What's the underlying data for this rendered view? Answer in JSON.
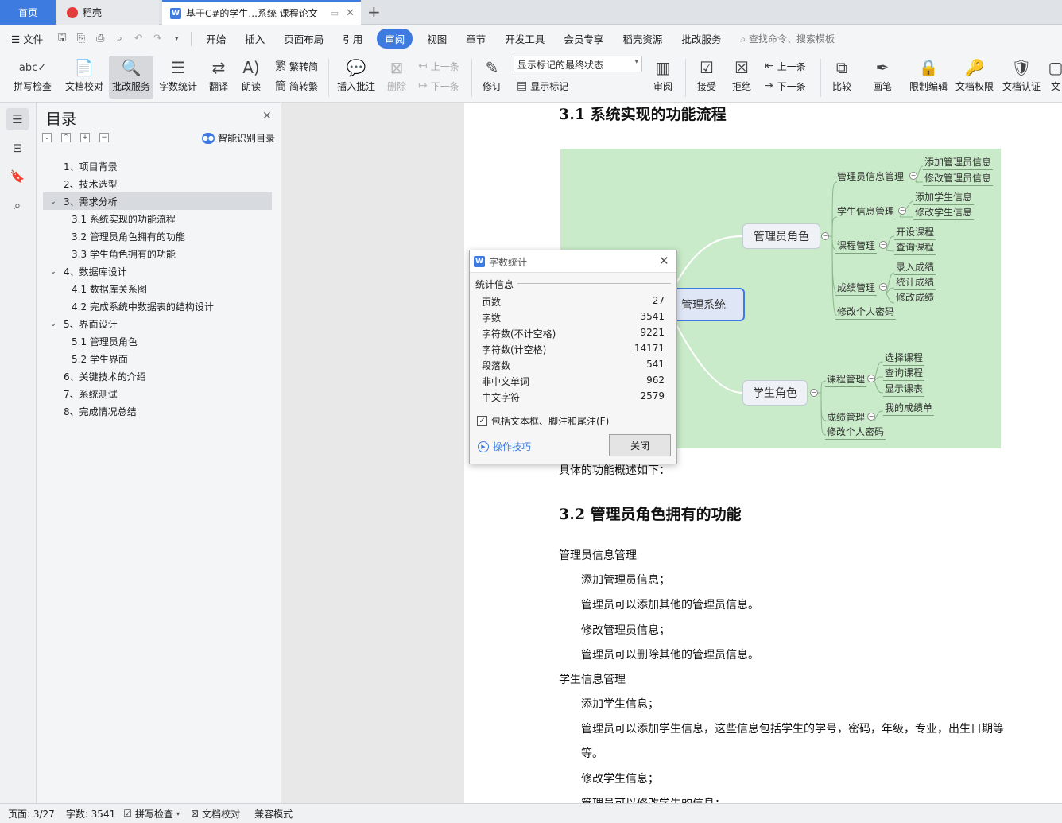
{
  "tabs": {
    "home": "首页",
    "daoke": "稻壳",
    "doc": "基于C#的学生...系统 课程论文"
  },
  "menu": {
    "file": "文件",
    "items": [
      "开始",
      "插入",
      "页面布局",
      "引用",
      "审阅",
      "视图",
      "章节",
      "开发工具",
      "会员专享",
      "稻壳资源",
      "批改服务"
    ],
    "active": "审阅",
    "search_placeholder": "查找命令、搜索模板"
  },
  "ribbon": {
    "spellcheck": "拼写检查",
    "doc_check": "文档校对",
    "correction_service": "批改服务",
    "word_count": "字数统计",
    "translate": "翻译",
    "read_aloud": "朗读",
    "trad_to_simp": "繁转简",
    "simp_to_trad": "简转繁",
    "insert_comment": "插入批注",
    "delete": "删除",
    "prev_comment": "上一条",
    "next_comment": "下一条",
    "track_changes": "修订",
    "markup_state": "显示标记的最终状态",
    "show_markup": "显示标记",
    "review": "审阅",
    "accept": "接受",
    "reject": "拒绝",
    "prev_change": "上一条",
    "next_change": "下一条",
    "compare": "比较",
    "pen": "画笔",
    "restrict_edit": "限制编辑",
    "doc_permission": "文档权限",
    "doc_certify": "文档认证",
    "more": "文"
  },
  "toc": {
    "title": "目录",
    "smart_label": "智能识别目录",
    "items": [
      {
        "label": "1、项目背景",
        "level": 1
      },
      {
        "label": "2、技术选型",
        "level": 1
      },
      {
        "label": "3、需求分析",
        "level": 1
      },
      {
        "label": "3.1 系统实现的功能流程",
        "level": 2
      },
      {
        "label": "3.2 管理员角色拥有的功能",
        "level": 2
      },
      {
        "label": "3.3 学生角色拥有的功能",
        "level": 2
      },
      {
        "label": "4、数据库设计",
        "level": 1
      },
      {
        "label": "4.1 数据库关系图",
        "level": 2
      },
      {
        "label": "4.2 完成系统中数据表的结构设计",
        "level": 2
      },
      {
        "label": "5、界面设计",
        "level": 1
      },
      {
        "label": "5.1 管理员角色",
        "level": 2
      },
      {
        "label": "5.2 学生界面",
        "level": 2
      },
      {
        "label": "6、关键技术的介绍",
        "level": 1
      },
      {
        "label": "7、系统测试",
        "level": 1
      },
      {
        "label": "8、完成情况总结",
        "level": 1
      }
    ]
  },
  "doc": {
    "heading1": "3.1 系统实现的功能流程",
    "after_figure": "具体的功能概述如下：",
    "heading2": "3.2 管理员角色拥有的功能",
    "lines": [
      "管理员信息管理",
      "添加管理员信息；",
      "管理员可以添加其他的管理员信息。",
      "修改管理员信息；",
      "管理员可以删除其他的管理员信息。",
      "学生信息管理",
      "添加学生信息；",
      "管理员可以添加学生信息，这些信息包括学生的学号，密码，年级，专业，出生日期等",
      "等。",
      "修改学生信息；",
      "管理员可以修改学生的信息；"
    ]
  },
  "mindmap": {
    "root": "管理系统",
    "admin": "管理员角色",
    "student": "学生角色",
    "admin_branches": [
      "管理员信息管理",
      "学生信息管理",
      "课程管理",
      "成绩管理",
      "修改个人密码"
    ],
    "admin_leaves": {
      "admin_info": [
        "添加管理员信息",
        "修改管理员信息"
      ],
      "student_info": [
        "添加学生信息",
        "修改学生信息"
      ],
      "course": [
        "开设课程",
        "查询课程"
      ],
      "score": [
        "录入成绩",
        "统计成绩",
        "修改成绩"
      ]
    },
    "student_branches": [
      "课程管理",
      "成绩管理",
      "修改个人密码"
    ],
    "student_leaves": {
      "course": [
        "选择课程",
        "查询课程",
        "显示课表"
      ],
      "score": [
        "我的成绩单"
      ]
    }
  },
  "dialog": {
    "title": "字数统计",
    "section": "统计信息",
    "stats": [
      {
        "label": "页数",
        "value": "27"
      },
      {
        "label": "字数",
        "value": "3541"
      },
      {
        "label": "字符数(不计空格)",
        "value": "9221"
      },
      {
        "label": "字符数(计空格)",
        "value": "14171"
      },
      {
        "label": "段落数",
        "value": "541"
      },
      {
        "label": "非中文单词",
        "value": "962"
      },
      {
        "label": "中文字符",
        "value": "2579"
      }
    ],
    "checkbox": "包括文本框、脚注和尾注(F)",
    "tips": "操作技巧",
    "close": "关闭"
  },
  "status": {
    "page": "页面: 3/27",
    "words": "字数: 3541",
    "spell": "拼写检查",
    "doccheck": "文档校对",
    "compat": "兼容模式"
  },
  "colors": {
    "accent": "#3d7be0",
    "mindmap_bg": "#c9ebc9"
  }
}
